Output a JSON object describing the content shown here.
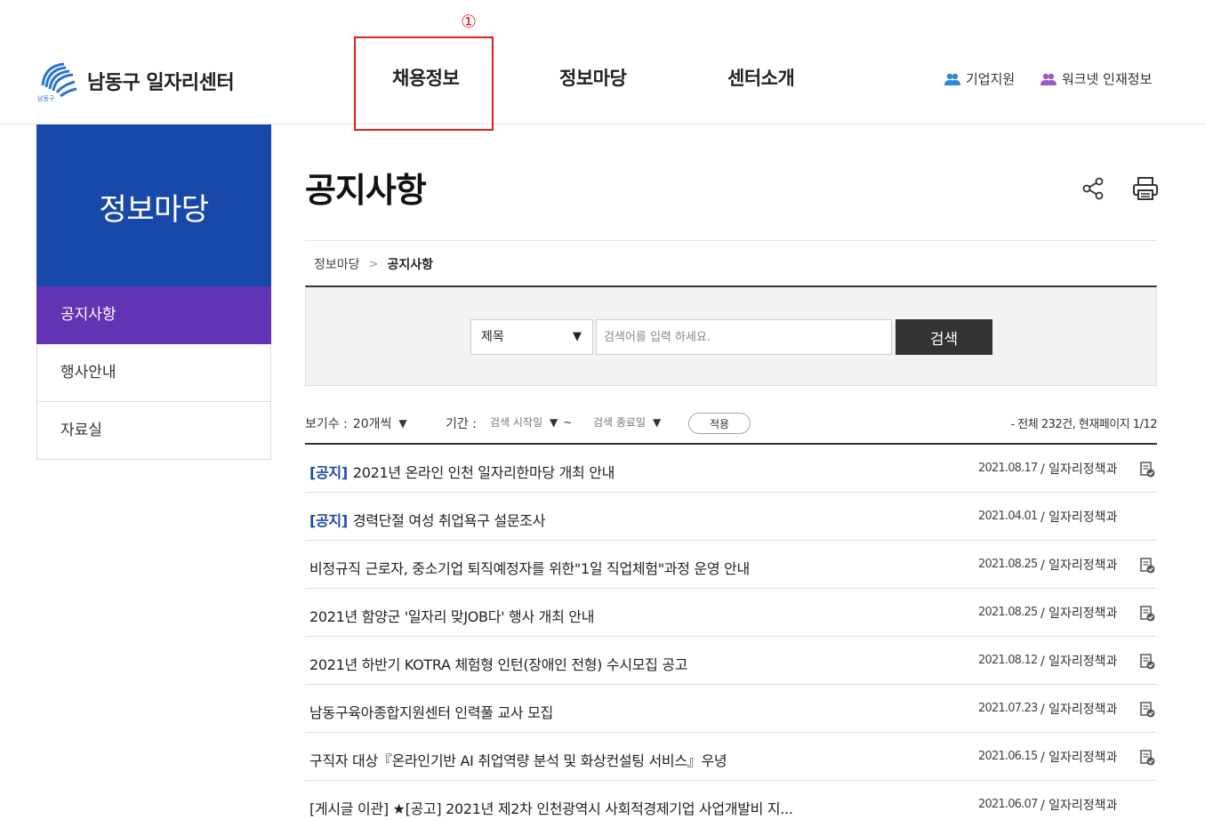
{
  "header": {
    "logo_text": "남동구 일자리센터",
    "logo_mark_text": "남동구",
    "step_marker": "①",
    "gnb": [
      "채용정보",
      "정보마당",
      "센터소개"
    ],
    "util": [
      {
        "label": "기업지원",
        "icon": "users-icon",
        "color": "#2a8ad8"
      },
      {
        "label": "워크넷 인재정보",
        "icon": "users-icon",
        "color": "#9b59c8"
      }
    ]
  },
  "sidebar": {
    "title": "정보마당",
    "items": [
      "공지사항",
      "행사안내",
      "자료실"
    ],
    "active_index": 0,
    "banner_color": "#1849a9",
    "active_color": "#6234b4"
  },
  "content": {
    "page_title": "공지사항",
    "breadcrumb": [
      "정보마당",
      "공지사항"
    ],
    "search": {
      "select_value": "제목",
      "placeholder": "검색어를 입력 하세요.",
      "button": "검색"
    },
    "filter": {
      "count_label": "보기수 :",
      "count_value": "20개씩",
      "period_label": "기간 :",
      "start_placeholder": "검색 시작일",
      "tilde": "~",
      "end_placeholder": "검색 종료일",
      "apply": "적용",
      "total": "- 전체 232건, 현재페이지 1/12"
    },
    "rows": [
      {
        "tag": "[공지]",
        "title": "2021년 온라인 인천 일자리한마당 개최 안내",
        "date": "2021.08.17",
        "dept": "/ 일자리정책과",
        "file": true
      },
      {
        "tag": "[공지]",
        "title": "경력단절 여성 취업욕구 설문조사",
        "date": "2021.04.01",
        "dept": "/ 일자리정책과",
        "file": false
      },
      {
        "tag": "",
        "title": "비정규직 근로자, 중소기업 퇴직예정자를 위한\"1일 직업체험\"과정 운영 안내",
        "date": "2021.08.25",
        "dept": "/ 일자리정책과",
        "file": true
      },
      {
        "tag": "",
        "title": "2021년 함양군 '일자리 맞JOB다' 행사 개최 안내",
        "date": "2021.08.25",
        "dept": "/ 일자리정책과",
        "file": true
      },
      {
        "tag": "",
        "title": "2021년 하반기 KOTRA 체험형 인턴(장애인 전형) 수시모집 공고",
        "date": "2021.08.12",
        "dept": "/ 일자리정책과",
        "file": true
      },
      {
        "tag": "",
        "title": "남동구육아종합지원센터 인력풀 교사 모집",
        "date": "2021.07.23",
        "dept": "/ 일자리정책과",
        "file": true
      },
      {
        "tag": "",
        "title": "구직자 대상『온라인기반 AI 취업역량 분석 및 화상컨설팅 서비스』우녕",
        "date": "2021.06.15",
        "dept": "/ 일자리정책과",
        "file": true
      },
      {
        "tag": "",
        "title": "[게시글 이관] ★[공고] 2021년 제2차 인천광역시 사회적경제기업 사업개발비 지...",
        "date": "2021.06.07",
        "dept": "/ 일자리정책과",
        "file": false
      }
    ]
  }
}
